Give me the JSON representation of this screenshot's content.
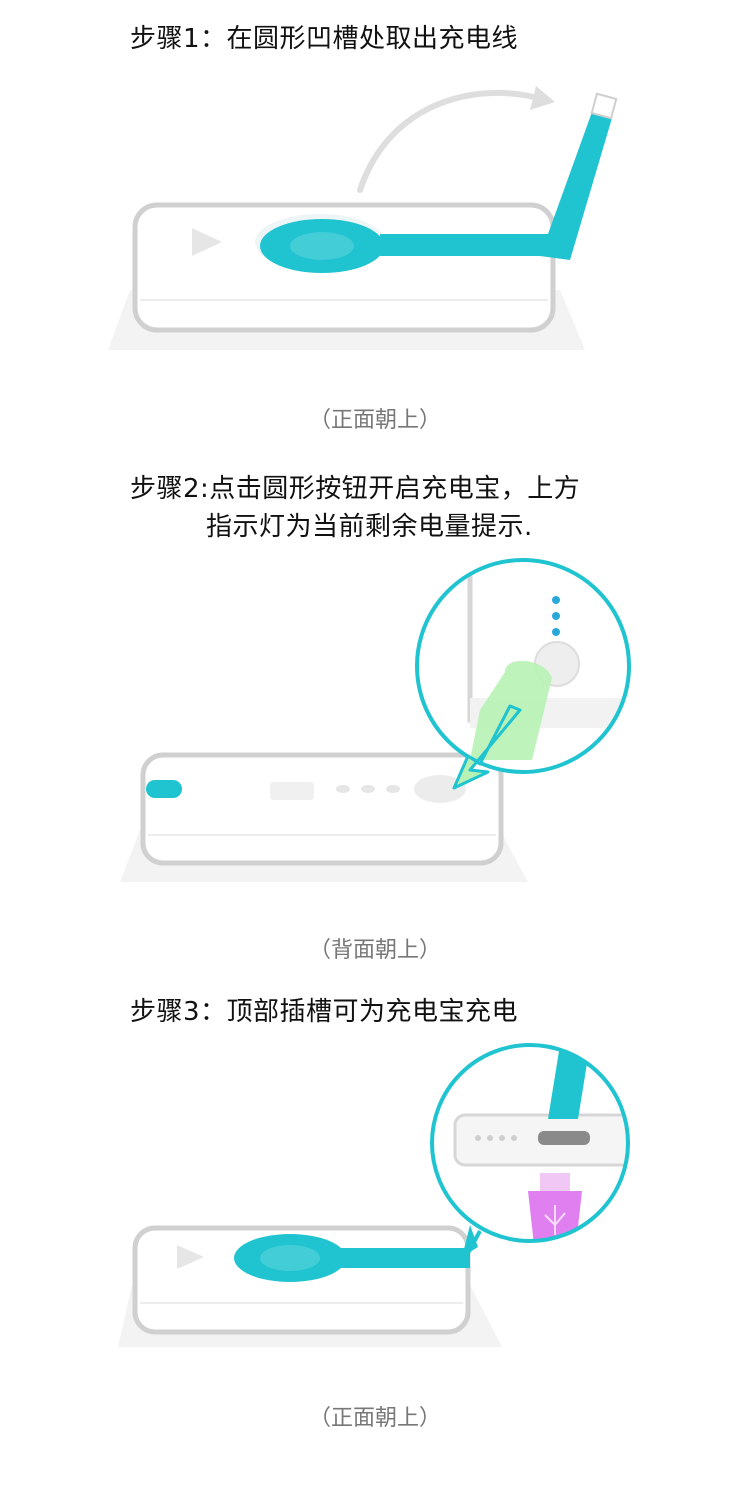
{
  "step1": {
    "title": "步骤1：在圆形凹槽处取出充电线",
    "caption": "（正面朝上）"
  },
  "step2": {
    "title_line1": "步骤2:点击圆形按钮开启充电宝，上方",
    "title_line2": "指示灯为当前剩余电量提示.",
    "caption": "（背面朝上）"
  },
  "step3": {
    "title": "步骤3：顶部插槽可为充电宝充电",
    "caption": "（正面朝上）"
  },
  "colors": {
    "accent_cyan": "#1fc4d0",
    "cable_light": "#7fdde6",
    "finger_green": "#b7f2b4",
    "usb_pink": "#e07ff0",
    "device_outline": "#d0d0d0",
    "caption_gray": "#777777"
  }
}
